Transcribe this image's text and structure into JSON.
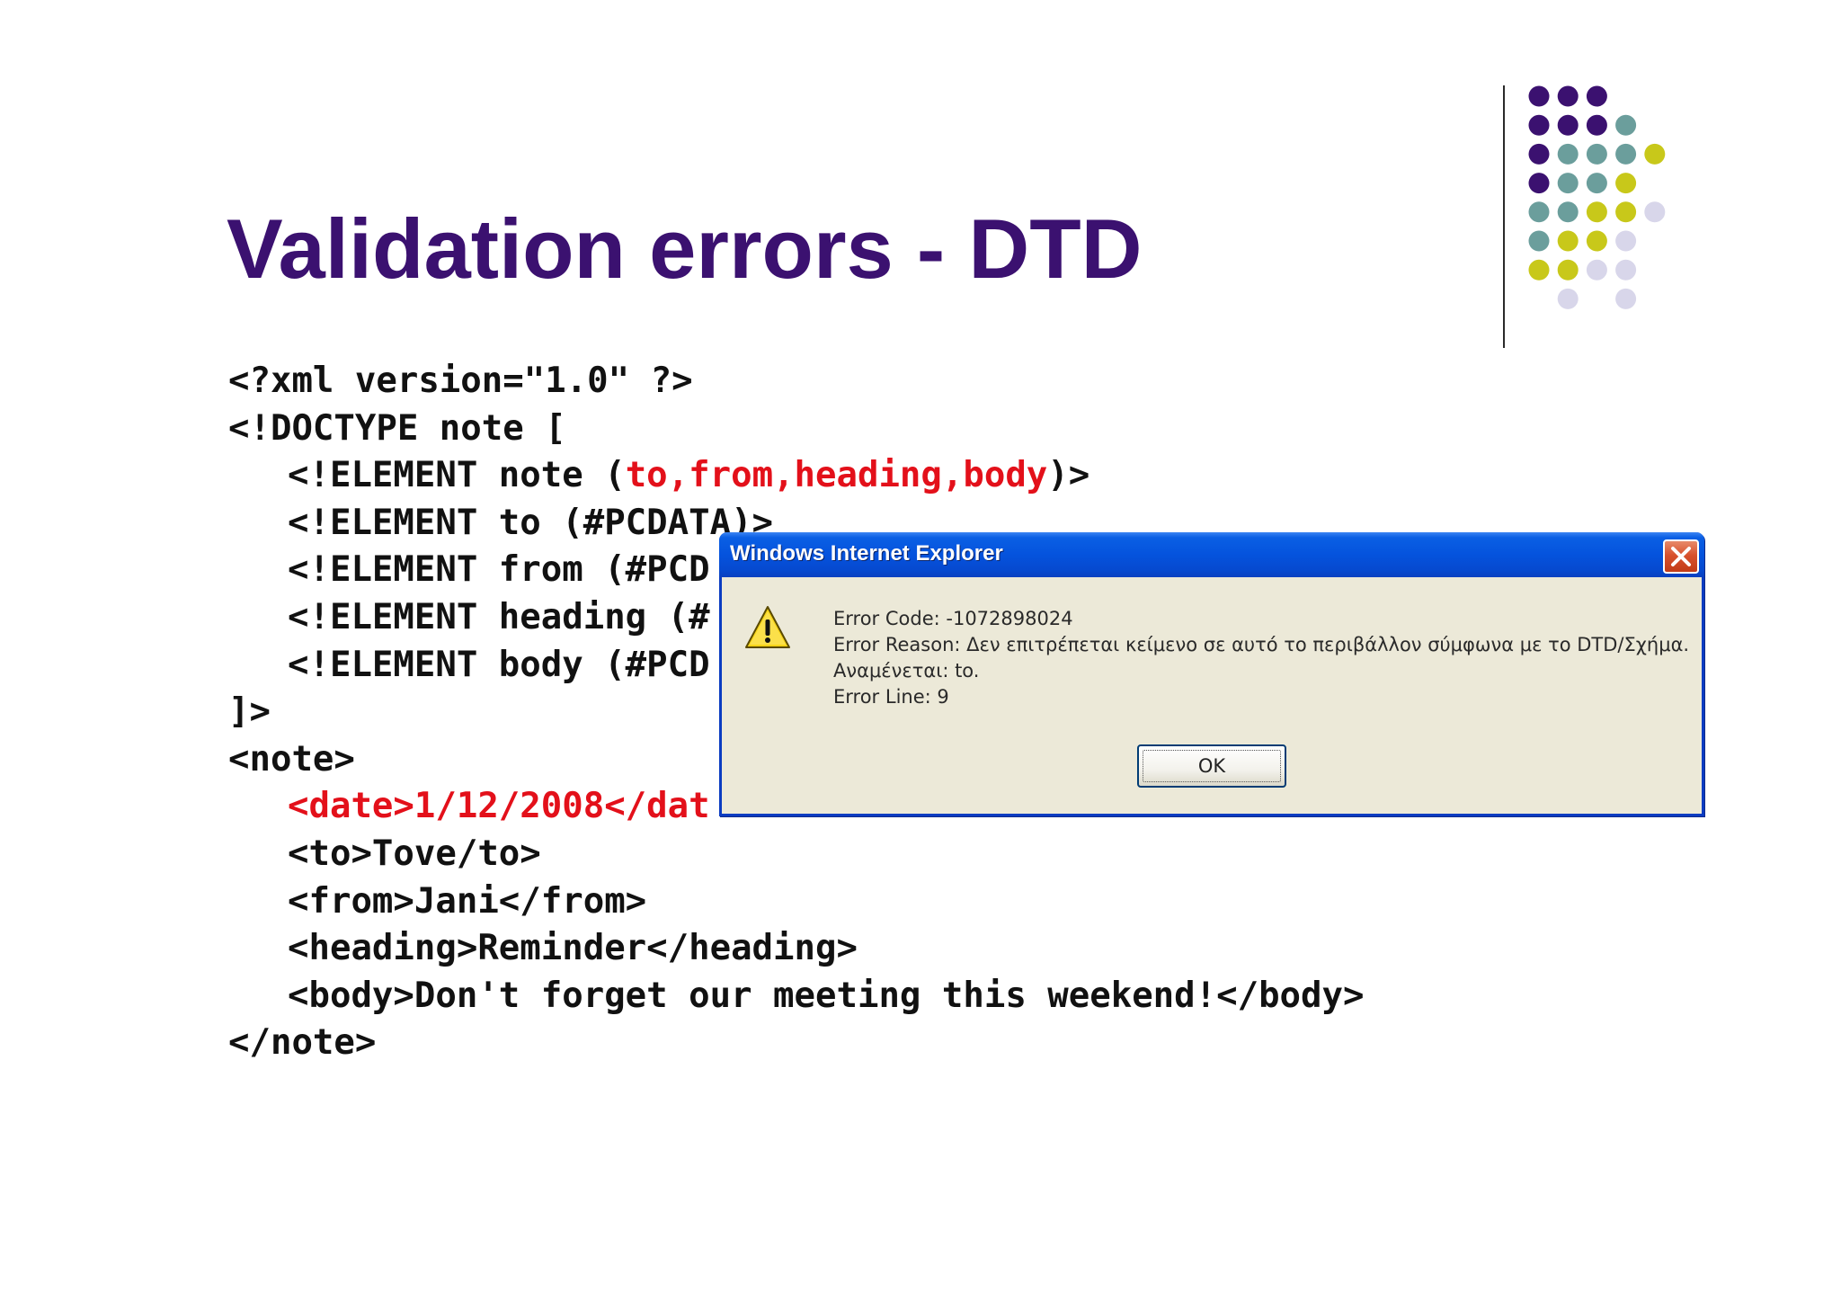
{
  "slide": {
    "title": "Validation errors - DTD"
  },
  "decoration": {
    "dot_colors": {
      "purple": "#3b1170",
      "teal": "#6b9e9c",
      "olive": "#c8c81a",
      "lavender": "#d8d6ea"
    }
  },
  "code": {
    "accent_color": "#e3101a",
    "l1": "<?xml version=\"1.0\" ?>",
    "l2": "<!DOCTYPE note [",
    "l3_a": "<!ELEMENT note (",
    "l3_red": "to,from,heading,body",
    "l3_b": ")>",
    "l4": "<!ELEMENT to (#PCDATA)>",
    "l5": "<!ELEMENT from (#PCD",
    "l6": "<!ELEMENT heading (#",
    "l7": "<!ELEMENT body (#PCD",
    "l8": "]>",
    "l9": "<note>",
    "l10": "<date>1/12/2008</dat",
    "l11": "<to>Tove/to>",
    "l12": "<from>Jani</from>",
    "l13": "<heading>Reminder</heading>",
    "l14": "<body>Don't forget our meeting this weekend!</body>",
    "l15": "</note>"
  },
  "dialog": {
    "title": "Windows Internet Explorer",
    "close_icon": "close-icon",
    "warning_icon": "warning-icon",
    "error_code": "Error Code: -1072898024",
    "error_reason": "Error Reason: Δεν επιτρέπεται κείμενο σε αυτό το περιβάλλον σύμφωνα με το DTD/Σχήμα.",
    "expected": "Αναμένεται: to.",
    "error_line": "Error Line: 9",
    "ok_label": "OK"
  }
}
